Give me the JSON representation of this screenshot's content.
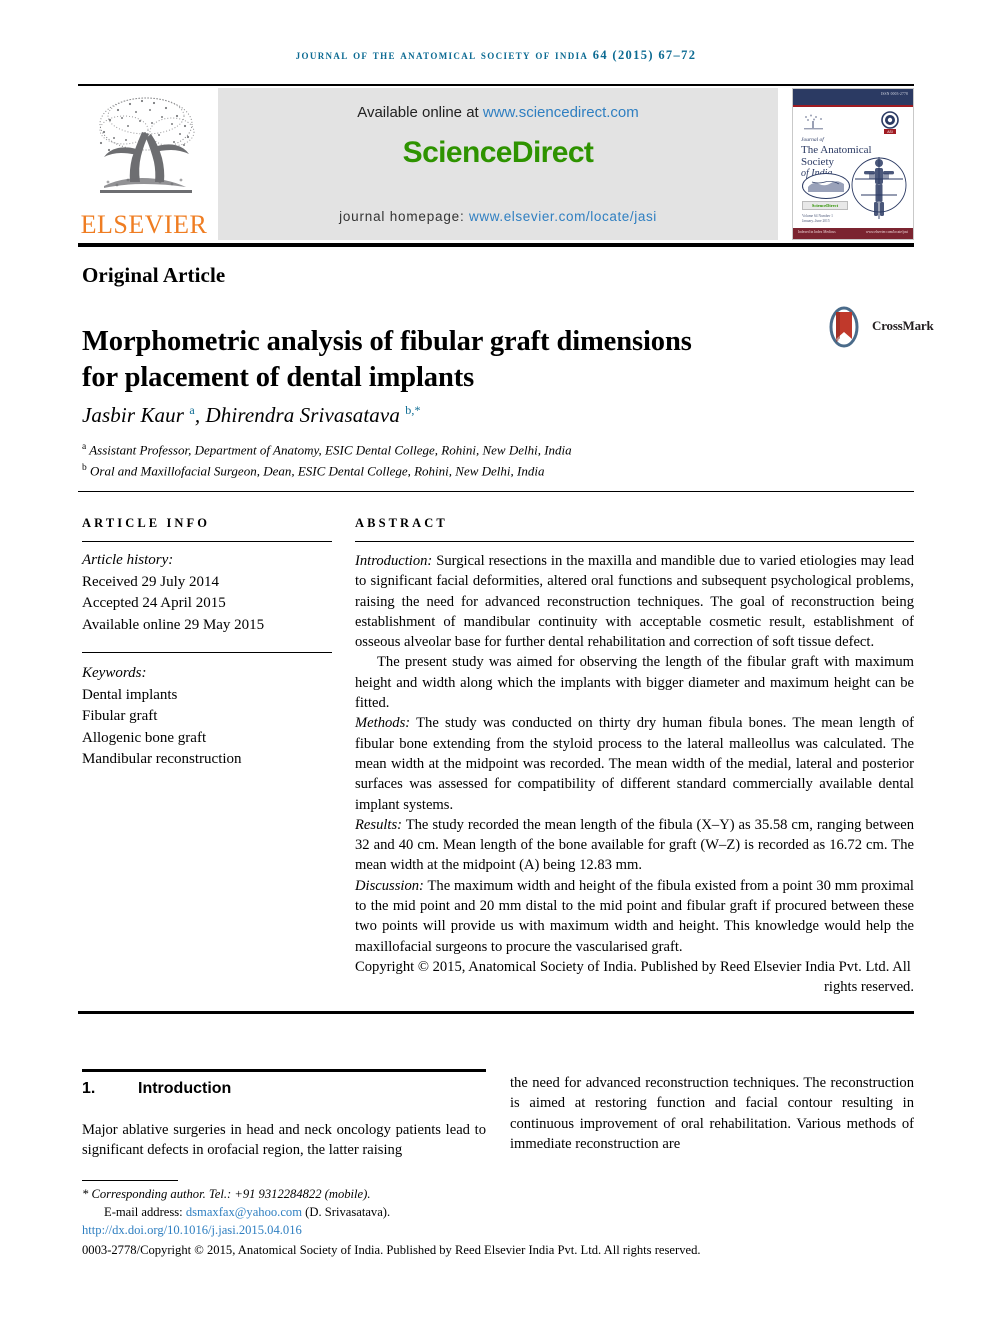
{
  "running_head": "journal of the anatomical society of india 64 (2015) 67–72",
  "header": {
    "publisher_logo_name": "elsevier-tree-logo",
    "publisher_wordmark": "ELSEVIER",
    "available_prefix": "Available online at ",
    "available_link": "www.sciencedirect.com",
    "sciencedirect_wordmark": "ScienceDirect",
    "homepage_prefix": "journal homepage: ",
    "homepage_link": "www.elsevier.com/locate/jasi",
    "cover": {
      "issn_top": "ISSN 0003-2778",
      "journal_of": "Journal of",
      "title_line1": "The Anatomical Society",
      "title_line2": "of India",
      "badge": "ScienceDirect",
      "small_text_line1": "Volume 64 Number 1",
      "small_text_line2": "January–June 2015",
      "foot_left": "Indexed in Index Medicus",
      "foot_right": "www.elsevier.com/locate/jasi"
    }
  },
  "article": {
    "kicker": "Original Article",
    "title_line1": "Morphometric analysis of fibular graft dimensions",
    "title_line2": "for placement of dental implants",
    "crossmark_label": "CrossMark",
    "authors_html": "Jasbir Kaur <sup>a</sup>, Dhirendra Srivasatava <sup>b,*</sup>",
    "affiliation_a_marker": "a",
    "affiliation_a": "Assistant Professor, Department of Anatomy, ESIC Dental College, Rohini, New Delhi, India",
    "affiliation_b_marker": "b",
    "affiliation_b": "Oral and Maxillofacial Surgeon, Dean, ESIC Dental College, Rohini, New Delhi, India"
  },
  "article_info": {
    "heading": "ARTICLE INFO",
    "history_label": "Article history:",
    "received": "Received 29 July 2014",
    "accepted": "Accepted 24 April 2015",
    "available_online": "Available online 29 May 2015",
    "keywords_label": "Keywords:",
    "keywords": [
      "Dental implants",
      "Fibular graft",
      "Allogenic bone graft",
      "Mandibular reconstruction"
    ]
  },
  "abstract": {
    "heading": "ABSTRACT",
    "introduction_label": "Introduction:",
    "introduction_text": " Surgical resections in the maxilla and mandible due to varied etiologies may lead to significant facial deformities, altered oral functions and subsequent psychological problems, raising the need for advanced reconstruction techniques. The goal of reconstruction being establishment of mandibular continuity with acceptable cosmetic result, establishment of osseous alveolar base for further dental rehabilitation and correction of soft tissue defect.",
    "aim_paragraph": "The present study was aimed for observing the length of the fibular graft with maximum height and width along which the implants with bigger diameter and maximum height can be fitted.",
    "methods_label": "Methods:",
    "methods_text": " The study was conducted on thirty dry human fibula bones. The mean length of fibular bone extending from the styloid process to the lateral malleollus was calculated. The mean width at the midpoint was recorded. The mean width of the medial, lateral and posterior surfaces was assessed for compatibility of different standard commercially available dental implant systems.",
    "results_label": "Results:",
    "results_text": " The study recorded the mean length of the fibula (X–Y) as 35.58 cm, ranging between 32 and 40 cm. Mean length of the bone available for graft (W–Z) is recorded as 16.72 cm. The mean width at the midpoint (A) being 12.83 mm.",
    "discussion_label": "Discussion:",
    "discussion_text": " The maximum width and height of the fibula existed from a point 30 mm proximal to the mid point and 20 mm distal to the mid point and fibular graft if procured between these two points will provide us with maximum width and height. This knowledge would help the maxillofacial surgeons to procure the vascularised graft.",
    "copyright": "Copyright © 2015, Anatomical Society of India. Published by Reed Elsevier India Pvt. Ltd. All",
    "rights": "rights reserved."
  },
  "body": {
    "section_number": "1.",
    "section_title": "Introduction",
    "left_paragraph": "Major ablative surgeries in head and neck oncology patients lead to significant defects in orofacial region, the latter raising",
    "right_paragraph": "the need for advanced reconstruction techniques. The reconstruction is aimed at restoring function and facial contour resulting in continuous improvement of oral rehabilitation. Various methods of immediate reconstruction are"
  },
  "footnotes": {
    "corresponding_marker": "*",
    "corresponding_author": "Corresponding author. Tel.: +91 9312284822 (mobile).",
    "email_label": "E-mail address: ",
    "email": "dsmaxfax@yahoo.com",
    "email_suffix": " (D. Srivasatava).",
    "doi": "http://dx.doi.org/10.1016/j.jasi.2015.04.016",
    "copyright_line": "0003-2778/Copyright © 2015, Anatomical Society of India. Published by Reed Elsevier India Pvt. Ltd. All rights reserved."
  },
  "colors": {
    "journal_header": "#0b6a92",
    "link": "#2f7fc1",
    "sciencedirect_green": "#2e9300",
    "elsevier_orange": "#ef7d22",
    "cover_navy": "#2b3a63",
    "crossmark_red": "#c0392b"
  }
}
